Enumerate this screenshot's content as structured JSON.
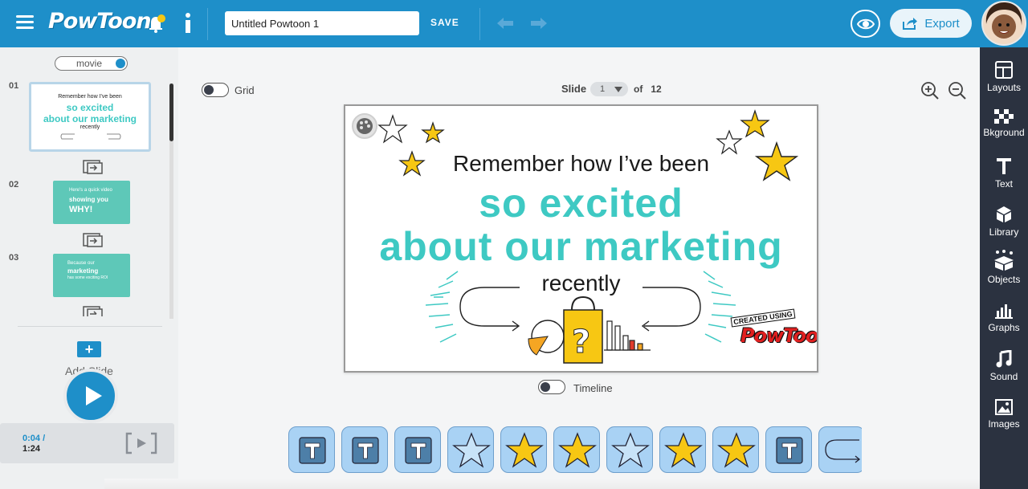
{
  "topbar": {
    "logo_text": "PowToon",
    "title_value": "Untitled Powtoon 1",
    "save_label": "SAVE",
    "export_label": "Export"
  },
  "rightbar": {
    "items": [
      {
        "label": "Layouts",
        "icon": "layouts-icon"
      },
      {
        "label": "Bkground",
        "icon": "background-icon"
      },
      {
        "label": "Text",
        "icon": "text-icon"
      },
      {
        "label": "Library",
        "icon": "library-icon"
      },
      {
        "label": "Objects",
        "icon": "objects-icon"
      },
      {
        "label": "Graphs",
        "icon": "graphs-icon"
      },
      {
        "label": "Sound",
        "icon": "sound-icon"
      },
      {
        "label": "Images",
        "icon": "images-icon"
      }
    ]
  },
  "leftpanel": {
    "mode_label": "movie",
    "slides": [
      {
        "number": "01",
        "line1": "Remember how I've been",
        "line2": "so excited",
        "line3": "about our marketing",
        "line4": "recently"
      },
      {
        "number": "02",
        "line1": "Here's a quick video",
        "line2": "showing you",
        "line3": "WHY!"
      },
      {
        "number": "03",
        "line1": "Because our",
        "line2": "marketing",
        "line3": "has some exciting ROI"
      }
    ],
    "add_slide_label": "Add Slide",
    "add_slide_symbol": "+",
    "time_current": "0:04 /",
    "time_total": "1:24"
  },
  "stage": {
    "grid_label": "Grid",
    "slide_label": "Slide",
    "slide_current": "1",
    "slide_of": "of",
    "slide_total": "12",
    "timeline_label": "Timeline",
    "canvas": {
      "line1": "Remember how I’ve been",
      "line2": "so excited",
      "line3": "about our marketing",
      "line4": "recently",
      "watermark_small": "CREATED USING",
      "watermark_big": "PowToon"
    }
  },
  "strip": {
    "items": [
      "text-icon",
      "text-icon",
      "text-icon",
      "star-outline-icon",
      "star-filled-icon",
      "star-filled-icon",
      "star-outline-icon",
      "star-filled-icon",
      "star-filled-icon",
      "text-icon",
      "arrow-icon"
    ]
  },
  "colors": {
    "brand": "#1e8fc9",
    "accent_teal": "#3ec9c3",
    "star_yellow": "#f7c713",
    "sidebar_dark": "#2b3240"
  }
}
